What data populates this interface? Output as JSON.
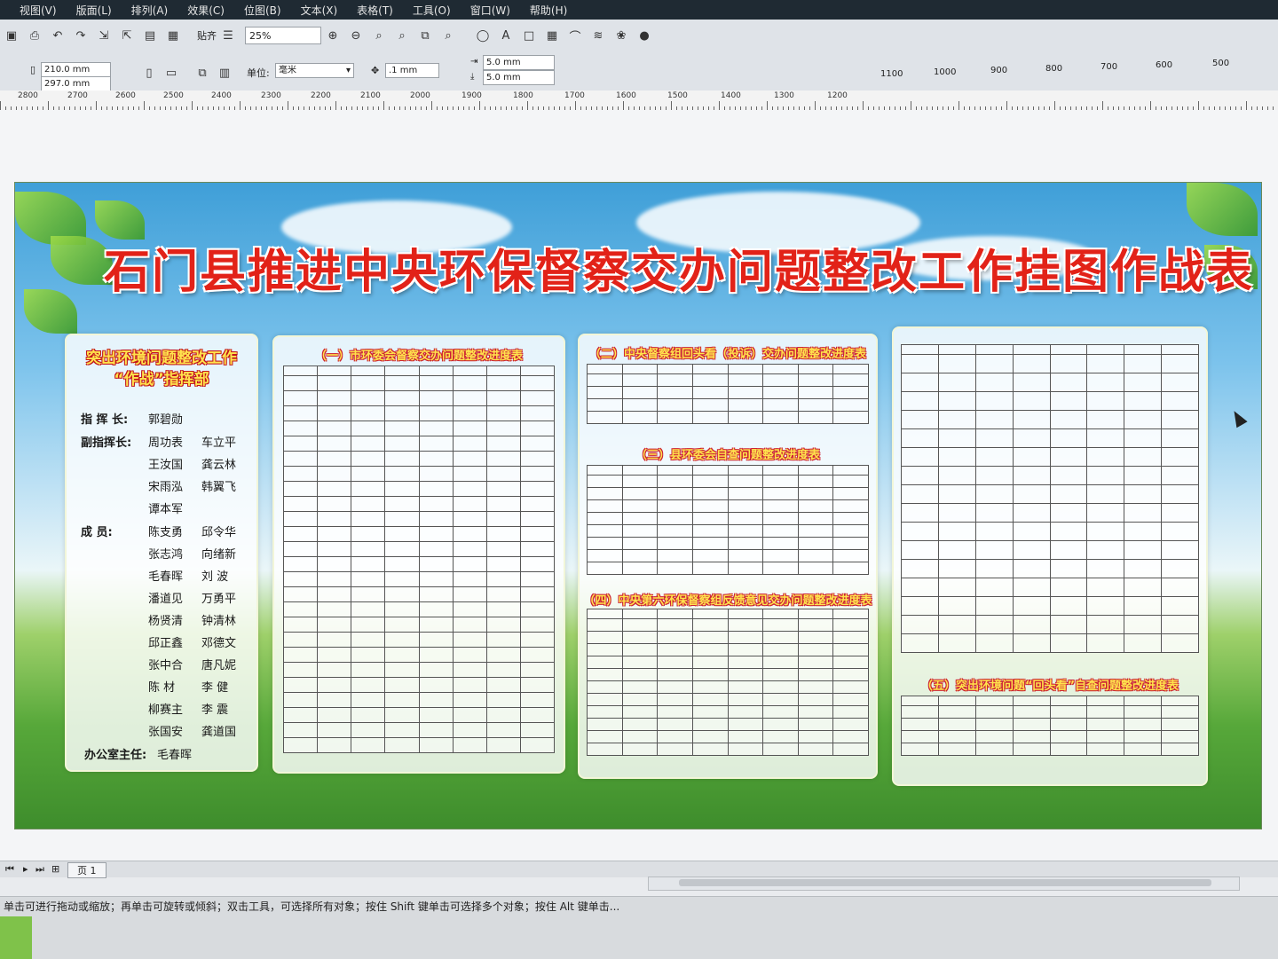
{
  "menu": [
    "视图(V)",
    "版面(L)",
    "排列(A)",
    "效果(C)",
    "位图(B)",
    "文本(X)",
    "表格(T)",
    "工具(O)",
    "窗口(W)",
    "帮助(H)"
  ],
  "toolbar": {
    "paste_label": "贴齐",
    "zoom": "25%"
  },
  "propbar": {
    "width": "210.0 mm",
    "height": "297.0 mm",
    "unit_label": "单位:",
    "unit_value": "毫米",
    "nudge": ".1 mm",
    "dup_x": "5.0 mm",
    "dup_y": "5.0 mm"
  },
  "ruler_top": [
    "1100",
    "1000",
    "900",
    "800",
    "700",
    "600",
    "500"
  ],
  "ruler_bottom": [
    "2800",
    "2700",
    "2600",
    "2500",
    "2400",
    "2300",
    "2200",
    "2100",
    "2000",
    "1900",
    "1800",
    "1700",
    "1600",
    "1500",
    "1400",
    "1300",
    "1200"
  ],
  "poster": {
    "title": "石门县推进中央环保督察交办问题整改工作挂图作战表",
    "command": {
      "title_line1": "突出环境问题整改工作",
      "title_line2": "“作战”指挥部",
      "commander_role": "指 挥 长:",
      "commander": "郭碧勋",
      "deputy_role": "副指挥长:",
      "deputies": [
        "周功表",
        "车立平",
        "王汝国",
        "龚云林",
        "宋雨泓",
        "韩翼飞",
        "谭本军"
      ],
      "member_role": "成    员:",
      "members": [
        "陈支勇",
        "邱令华",
        "张志鸿",
        "向绪新",
        "毛春晖",
        "刘  波",
        "潘道见",
        "万勇平",
        "杨贤清",
        "钟清林",
        "邱正鑫",
        "邓德文",
        "张中合",
        "唐凡妮",
        "陈  材",
        "李  健",
        "柳赛主",
        "李  震",
        "张国安",
        "龚道国"
      ],
      "office_role": "办公室主任:",
      "office_head": "毛春晖"
    },
    "sections": [
      "（一）市环委会督察交办问题整改进度表",
      "（二）中央督察组回头看（投诉）交办问题整改进度表",
      "（三）县环委会自查问题整改进度表",
      "（四）中央第六环保督察组反馈意见交办问题整改进度表",
      "（五）突出环境问题“回头看”自查问题整改进度表"
    ]
  },
  "pagebar": {
    "page_tab": "页 1"
  },
  "status": {
    "hint": "单击可进行拖动或缩放；再单击可旋转或倾斜；双击工具，可选择所有对象；按住 Shift 键单击可选择多个对象；按住 Alt 键单击..."
  }
}
